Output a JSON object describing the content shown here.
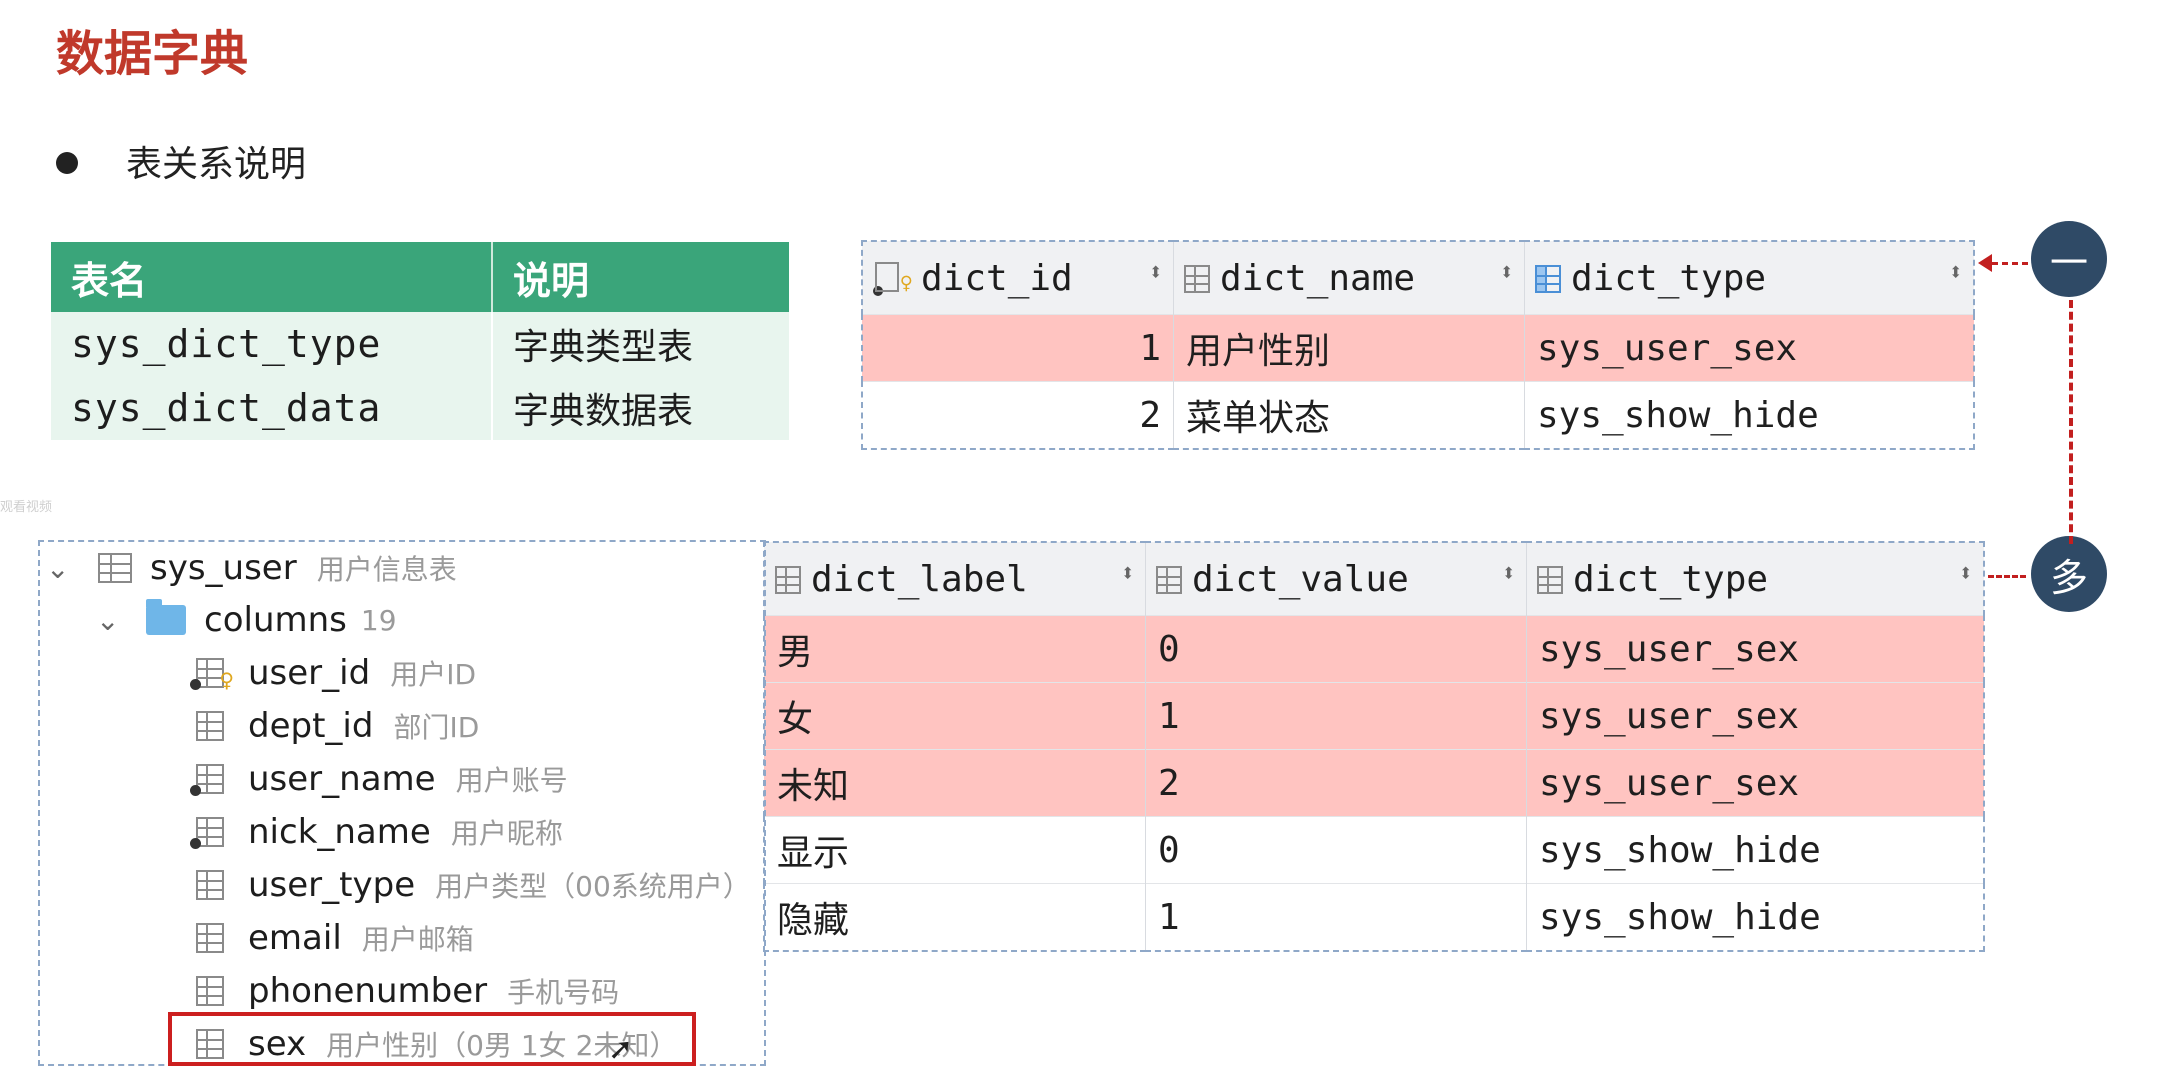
{
  "page": {
    "title": "数据字典",
    "bullet": "表关系说明",
    "watermark": "观看视频"
  },
  "relation_table": {
    "headers": [
      "表名",
      "说明"
    ],
    "rows": [
      {
        "name": "sys_dict_type",
        "desc": "字典类型表"
      },
      {
        "name": "sys_dict_data",
        "desc": "字典数据表"
      }
    ],
    "header_color": "#3aa57a",
    "row_color": "#e8f5ee"
  },
  "dict_type_grid": {
    "columns": [
      "dict_id",
      "dict_name",
      "dict_type"
    ],
    "rows": [
      {
        "id": "1",
        "name": "用户性别",
        "type": "sys_user_sex",
        "highlight": true
      },
      {
        "id": "2",
        "name": "菜单状态",
        "type": "sys_show_hide",
        "highlight": false
      }
    ]
  },
  "dict_data_grid": {
    "columns": [
      "dict_label",
      "dict_value",
      "dict_type"
    ],
    "rows": [
      {
        "label": "男",
        "value": "0",
        "type": "sys_user_sex",
        "highlight": true
      },
      {
        "label": "女",
        "value": "1",
        "type": "sys_user_sex",
        "highlight": true
      },
      {
        "label": "未知",
        "value": "2",
        "type": "sys_user_sex",
        "highlight": true
      },
      {
        "label": "显示",
        "value": "0",
        "type": "sys_show_hide",
        "highlight": false
      },
      {
        "label": "隐藏",
        "value": "1",
        "type": "sys_show_hide",
        "highlight": false
      }
    ],
    "highlight_color": "#ffc4c1"
  },
  "markers": {
    "one": "一",
    "many": "多",
    "line_color": "#c21f1f",
    "circle_color": "#2f4a66"
  },
  "tree": {
    "table": {
      "name": "sys_user",
      "comment": "用户信息表"
    },
    "folder": {
      "name": "columns",
      "count": "19"
    },
    "fields": [
      {
        "name": "user_id",
        "comment": "用户ID",
        "icon": "primary-key-column-icon"
      },
      {
        "name": "dept_id",
        "comment": "部门ID",
        "icon": "column-icon"
      },
      {
        "name": "user_name",
        "comment": "用户账号",
        "icon": "not-null-column-icon"
      },
      {
        "name": "nick_name",
        "comment": "用户昵称",
        "icon": "not-null-column-icon"
      },
      {
        "name": "user_type",
        "comment": "用户类型（00系统用户）",
        "icon": "column-icon"
      },
      {
        "name": "email",
        "comment": "用户邮箱",
        "icon": "column-icon"
      },
      {
        "name": "phonenumber",
        "comment": "手机号码",
        "icon": "column-icon"
      },
      {
        "name": "sex",
        "comment": "用户性别（0男 1女 2未知）",
        "icon": "column-icon"
      }
    ]
  }
}
